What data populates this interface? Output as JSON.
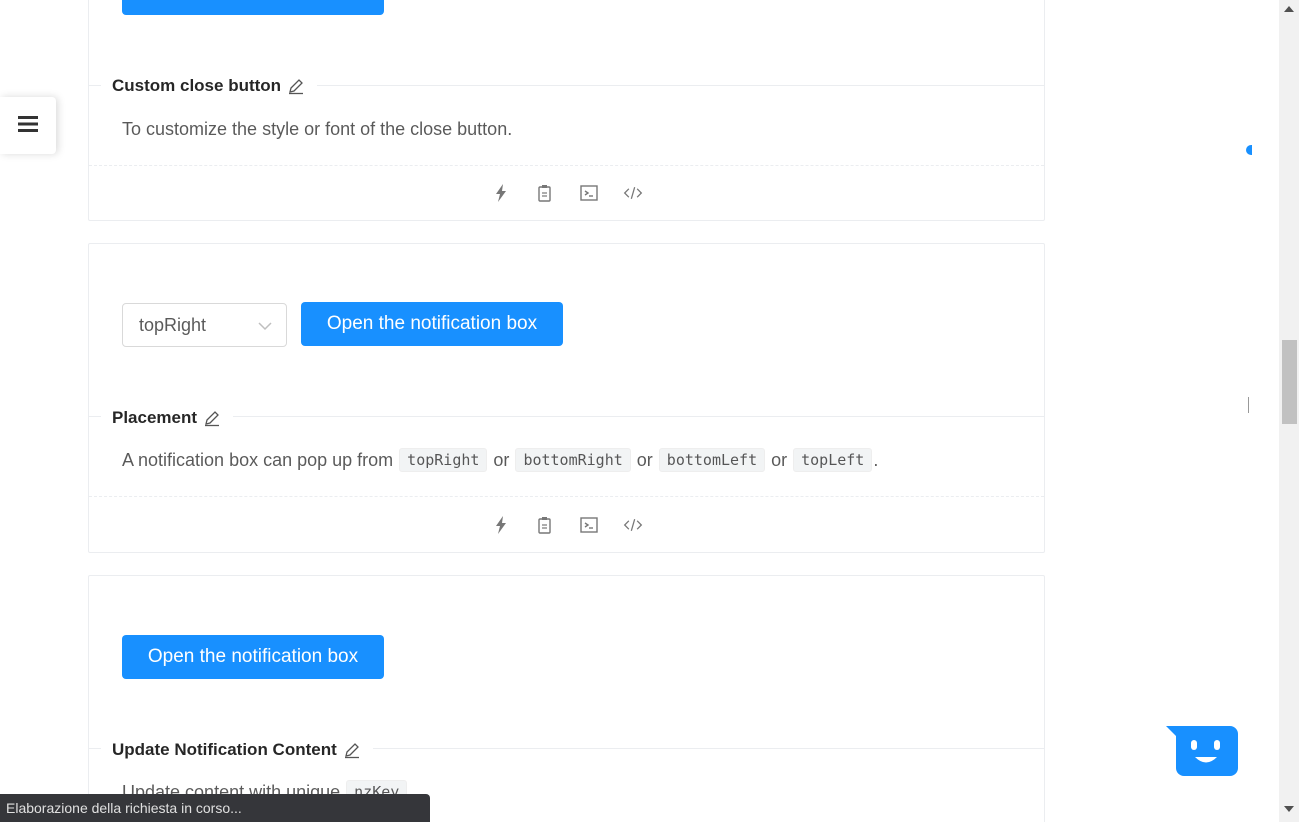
{
  "cards": {
    "close_button": {
      "title": "Custom close button",
      "description": "To customize the style or font of the close button."
    },
    "placement": {
      "select_value": "topRight",
      "open_button": "Open the notification box",
      "title": "Placement",
      "desc_prefix": "A notification box can pop up from",
      "options": [
        "topRight",
        "bottomRight",
        "bottomLeft",
        "topLeft"
      ],
      "or_word": "or",
      "desc_suffix": "."
    },
    "update": {
      "open_button": "Open the notification box",
      "title": "Update Notification Content",
      "desc_prefix": "Update content with unique",
      "code": "nzKey",
      "desc_suffix": "."
    }
  },
  "status_bar": {
    "text": "Elaborazione della richiesta in corso..."
  },
  "icons": {
    "edit": "edit-icon",
    "thunderbolt": "thunderbolt-icon",
    "copy": "copy-icon",
    "code_sandbox": "code-sandbox-icon",
    "code": "code-icon",
    "menu": "menu-icon"
  },
  "colors": {
    "primary": "#1890ff",
    "status_bar": "#35363a"
  }
}
